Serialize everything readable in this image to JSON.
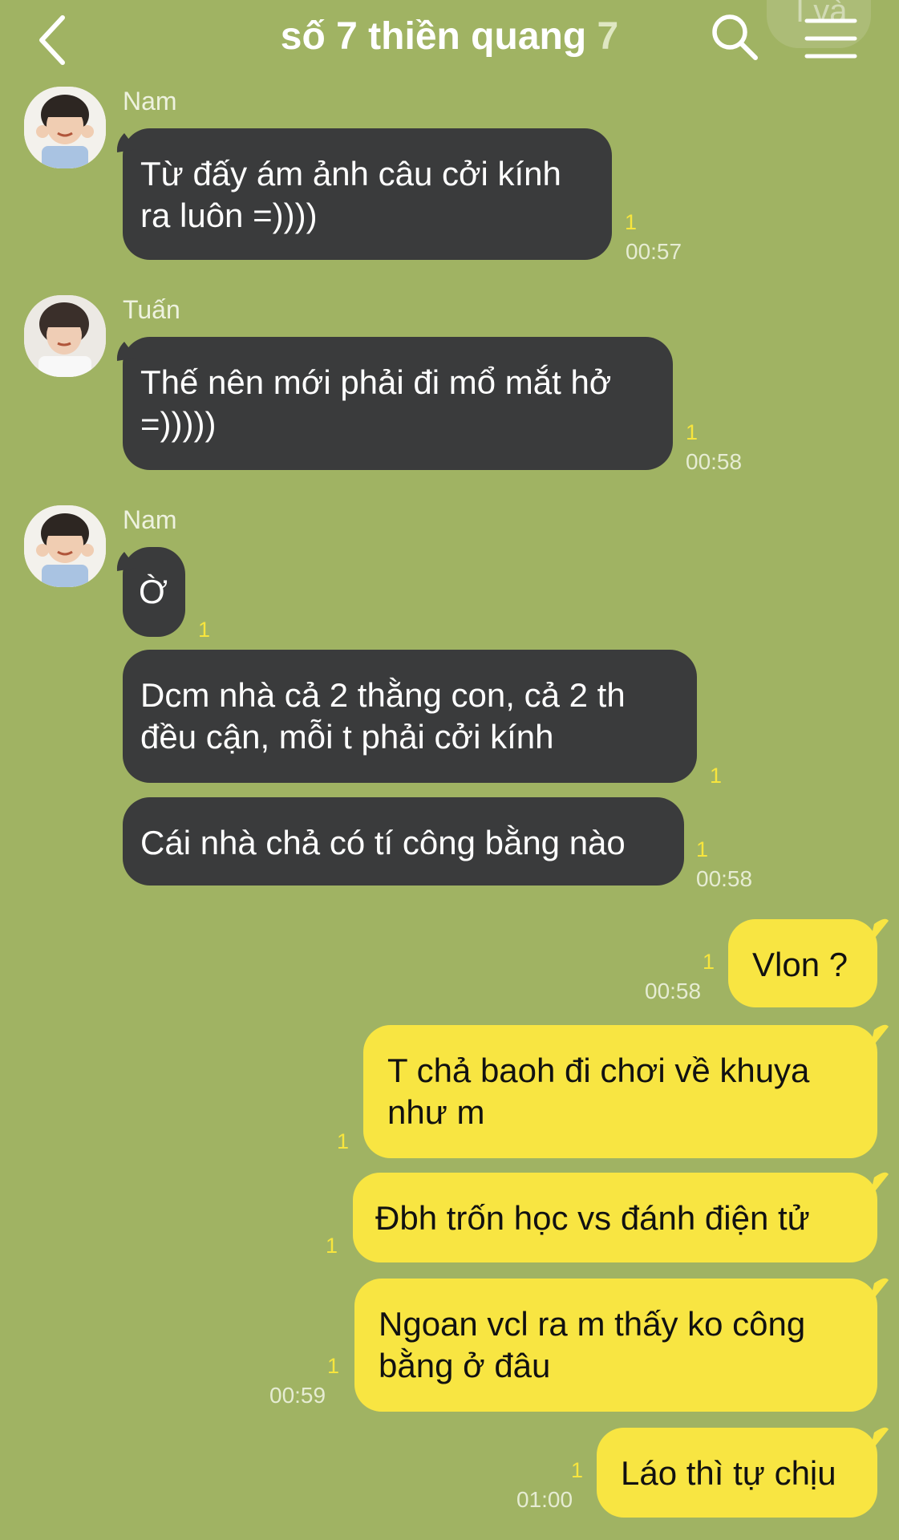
{
  "header": {
    "title": "số 7 thiền quang",
    "member_count": "7",
    "partial_top_right": "I và"
  },
  "messages": [
    {
      "sender": "Nam",
      "lines": [
        "Từ đấy ám ảnh câu cởi kính",
        "ra luôn =))))"
      ],
      "read": "1",
      "time": "00:57"
    },
    {
      "sender": "Tuấn",
      "lines": [
        "Thế nên mới phải đi mổ mắt hở",
        "=)))))"
      ],
      "read": "1",
      "time": "00:58"
    },
    {
      "sender": "Nam",
      "lines": [
        "Ờ"
      ],
      "read": "1",
      "time": ""
    },
    {
      "sender": "",
      "lines": [
        "Dcm nhà cả 2 thằng con, cả 2 th",
        "đều cận, mỗi t phải cởi kính"
      ],
      "read": "1",
      "time": ""
    },
    {
      "sender": "",
      "lines": [
        "Cái nhà chả có tí công bằng nào"
      ],
      "read": "1",
      "time": "00:58"
    },
    {
      "sender": "me",
      "lines": [
        "Vlon ?"
      ],
      "read": "1",
      "time": "00:58"
    },
    {
      "sender": "me",
      "lines": [
        "T chả baoh đi chơi về khuya",
        "như m"
      ],
      "read": "1",
      "time": ""
    },
    {
      "sender": "me",
      "lines": [
        "Đbh trốn học vs đánh điện tử"
      ],
      "read": "1",
      "time": ""
    },
    {
      "sender": "me",
      "lines": [
        "Ngoan vcl ra m thấy ko công",
        "bằng ở đâu"
      ],
      "read": "1",
      "time": "00:59"
    },
    {
      "sender": "me",
      "lines": [
        "Láo thì tự chịu"
      ],
      "read": "1",
      "time": "01:00"
    }
  ],
  "colors": {
    "background": "#a0b363",
    "incoming": "#3a3b3c",
    "outgoing": "#f8e542",
    "read_mark": "#f7e53d"
  }
}
